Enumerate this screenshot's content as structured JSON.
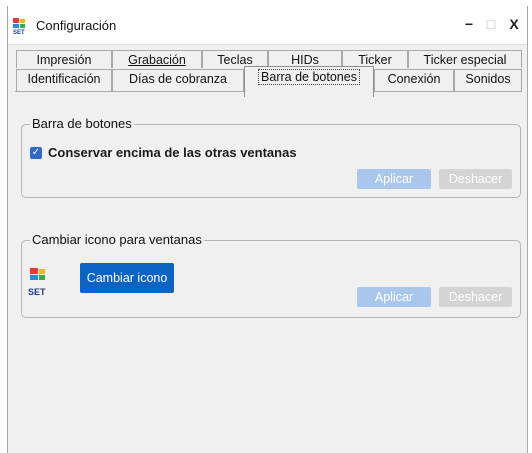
{
  "window": {
    "title": "Configuración",
    "minimize_glyph": "−",
    "maximize_glyph": "□",
    "close_glyph": "X"
  },
  "tabs_row1": [
    {
      "label": "Impresión"
    },
    {
      "label": "Grabación"
    },
    {
      "label": "Teclas"
    },
    {
      "label": "HIDs"
    },
    {
      "label": "Ticker"
    },
    {
      "label": "Ticker especial"
    }
  ],
  "tabs_row2": [
    {
      "label": "Identificación"
    },
    {
      "label": "Días de cobranza"
    },
    {
      "label": "Barra de botones",
      "active": true
    },
    {
      "label": "Conexión"
    },
    {
      "label": "Sonidos"
    }
  ],
  "group_barra": {
    "title": "Barra de botones",
    "checkbox_label": "Conservar encima de las otras ventanas",
    "checkbox_checked": true,
    "aplicar_label": "Aplicar",
    "deshacer_label": "Deshacer"
  },
  "group_icono": {
    "title": "Cambiar icono para ventanas",
    "icon_text": "SET",
    "change_button_label": "Cambiar icono",
    "aplicar_label": "Aplicar",
    "deshacer_label": "Deshacer"
  },
  "colors": {
    "accent": "#0b63c4",
    "checkbox": "#2f68c5",
    "disabled_apply": "#a9c7ec",
    "disabled_undo": "#d4d4d4"
  }
}
